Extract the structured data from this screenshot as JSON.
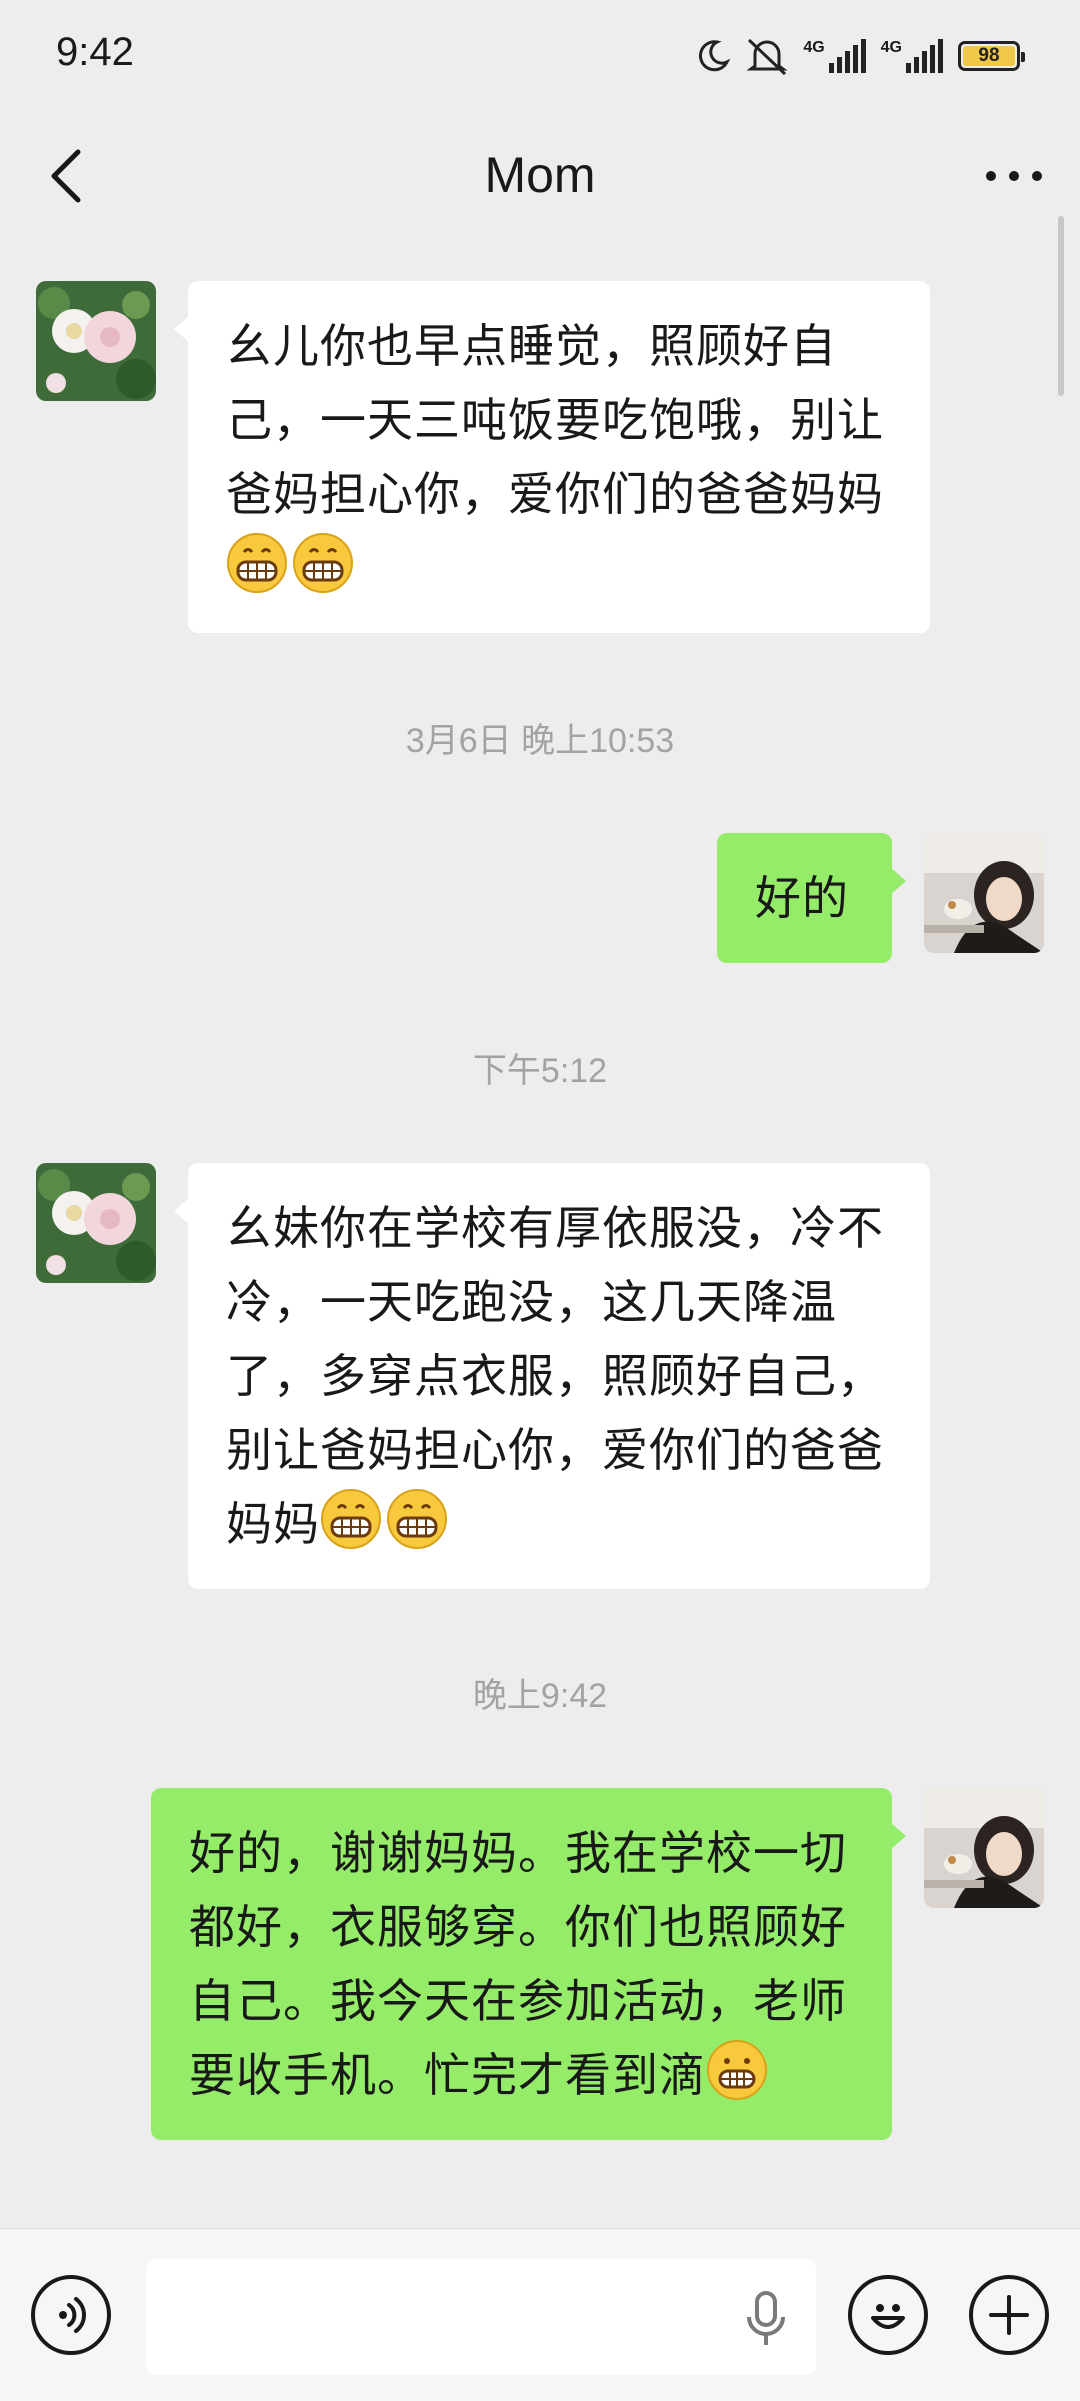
{
  "status_bar": {
    "time": "9:42",
    "network_1": "4G",
    "network_2": "4G",
    "battery": "98",
    "icons": [
      "moon-icon",
      "mute-icon",
      "signal-icon",
      "signal-icon",
      "battery-icon"
    ]
  },
  "header": {
    "title": "Mom",
    "back_icon": "chevron-left-icon",
    "more_icon": "more-dots-icon"
  },
  "messages": [
    {
      "side": "in",
      "text": "幺儿你也早点睡觉，照顾好自己，一天三吨饭要吃饱哦，别让爸妈担心你，爱你们的爸爸妈妈",
      "emoji": [
        "grin-emoji",
        "grin-emoji"
      ]
    },
    {
      "type": "timestamp",
      "text": "3月6日 晚上10:53"
    },
    {
      "side": "out",
      "text": "好的"
    },
    {
      "type": "timestamp",
      "text": "下午5:12"
    },
    {
      "side": "in",
      "text": "幺妹你在学校有厚依服没，冷不冷，一天吃跑没，这几天降温了，多穿点衣服，照顾好自己，别让爸妈担心你，爱你们的爸爸妈妈",
      "emoji": [
        "grin-emoji",
        "grin-emoji"
      ]
    },
    {
      "type": "timestamp",
      "text": "晚上9:42"
    },
    {
      "side": "out",
      "text": "好的，谢谢妈妈。我在学校一切都好，衣服够穿。你们也照顾好自己。我今天在参加活动，老师要收手机。忙完才看到滴",
      "emoji": [
        "grimace-emoji"
      ]
    }
  ],
  "bottom_bar": {
    "voice_icon": "voice-icon",
    "mic_icon": "microphone-icon",
    "emoji_icon": "emoji-smile-icon",
    "plus_icon": "plus-icon",
    "input_value": ""
  },
  "colors": {
    "background": "#ededed",
    "incoming_bubble": "#ffffff",
    "outgoing_bubble": "#95ec69",
    "timestamp": "#a3a3a3"
  }
}
